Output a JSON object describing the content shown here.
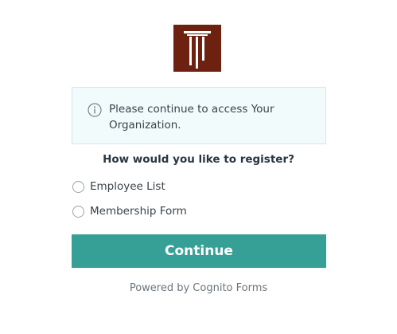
{
  "logo": {
    "icon": "column-logo-icon",
    "background": "#6d2110"
  },
  "info": {
    "icon": "info-icon",
    "message": "Please continue to access Your Organization."
  },
  "question": "How would you like to register?",
  "options": [
    {
      "label": "Employee List",
      "selected": false
    },
    {
      "label": "Membership Form",
      "selected": false
    }
  ],
  "continue_button": {
    "label": "Continue",
    "color": "#36a096"
  },
  "footer": {
    "powered_by": "Powered by Cognito Forms"
  }
}
